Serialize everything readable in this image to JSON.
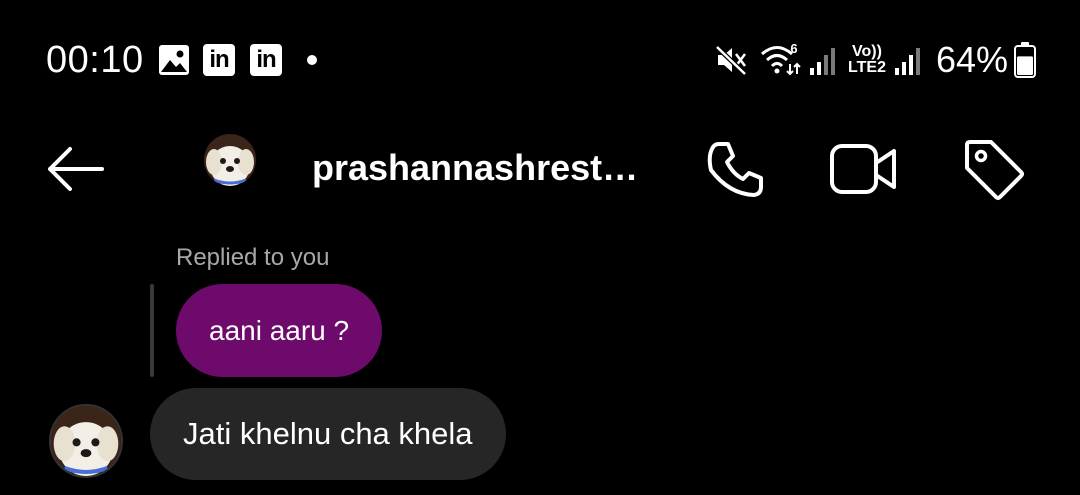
{
  "status_bar": {
    "time": "00:10",
    "notification_icons": [
      "gallery-icon",
      "linkedin-icon",
      "linkedin-icon"
    ],
    "linkedin_text": "in",
    "network_label_top": "Vo))",
    "network_label_bottom": "LTE2",
    "wifi_label": "6",
    "battery_percent": "64%",
    "battery_level": 0.64
  },
  "header": {
    "username": "prashannashrest…",
    "actions": [
      "back-arrow-icon",
      "phone-icon",
      "video-camera-icon",
      "tag-icon"
    ]
  },
  "conversation": {
    "reply_label": "Replied to you",
    "replied_message": "aani aaru ?",
    "message": "Jati khelnu cha khela"
  },
  "colors": {
    "background": "#000000",
    "replied_bubble": "#6d0a6b",
    "message_bubble": "#262626",
    "secondary_text": "#a8a8a8"
  }
}
